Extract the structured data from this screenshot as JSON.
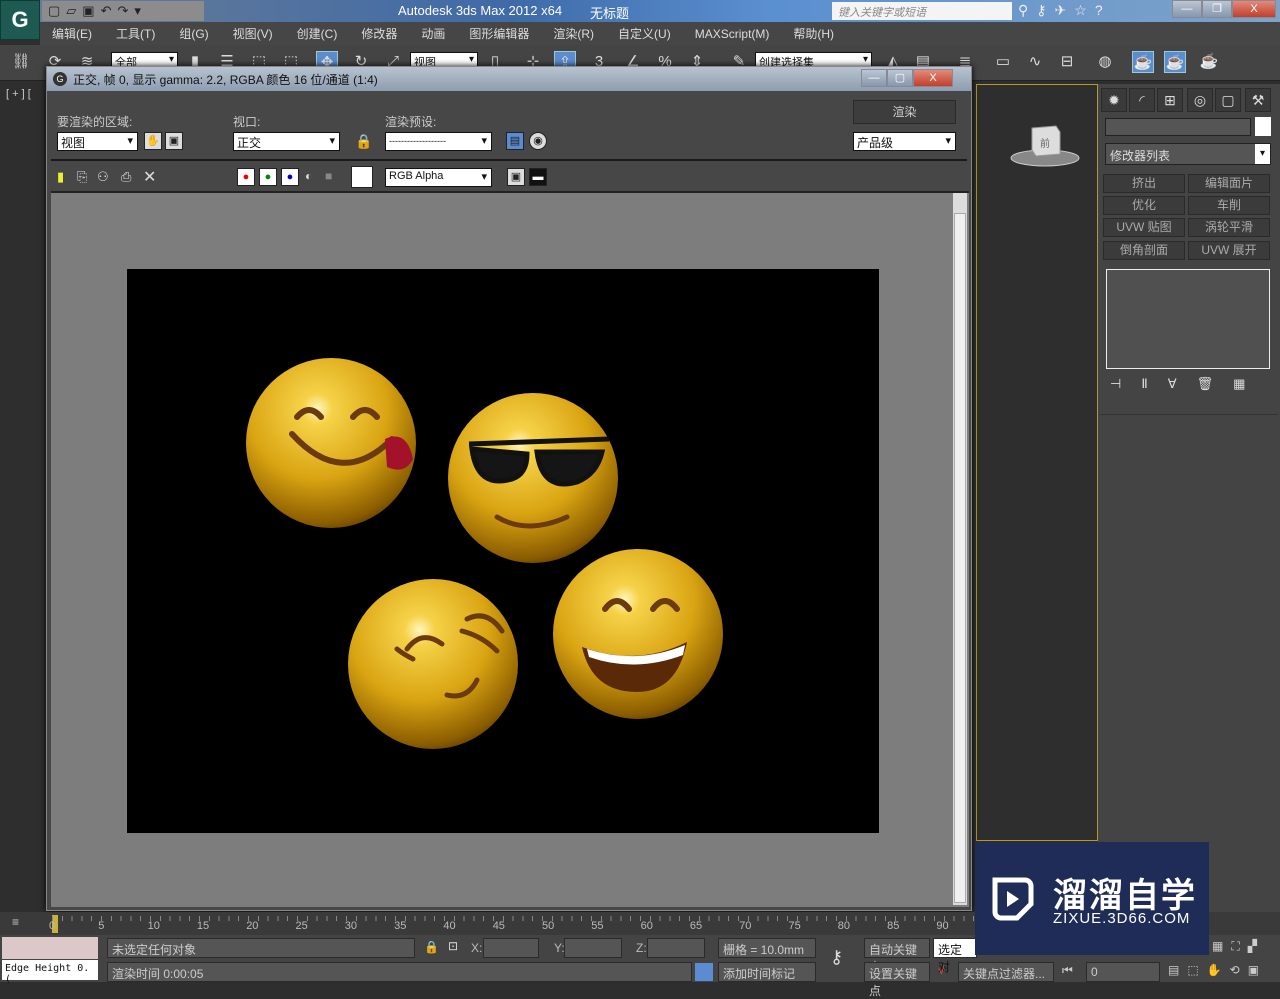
{
  "titlebar": {
    "app_title": "Autodesk 3ds Max  2012 x64",
    "doc_title": "无标题",
    "search_placeholder": "键入关键字或短语"
  },
  "menu": [
    "编辑(E)",
    "工具(T)",
    "组(G)",
    "视图(V)",
    "创建(C)",
    "修改器",
    "动画",
    "图形编辑器",
    "渲染(R)",
    "自定义(U)",
    "MAXScript(M)",
    "帮助(H)"
  ],
  "toolbar": {
    "selection_filter": "全部",
    "ref_coord": "视图",
    "named_selection": "创建选择集",
    "snap_label": "3",
    "percent_label": "%"
  },
  "viewport": {
    "label": "[ + ] [",
    "viewcube_label": "前"
  },
  "render_frame": {
    "title": "正交, 帧 0, 显示 gamma: 2.2, RGBA 颜色 16 位/通道 (1:4)",
    "area_label": "要渲染的区域:",
    "area_value": "视图",
    "viewport_label": "视口:",
    "viewport_value": "正交",
    "preset_label": "渲染预设:",
    "preset_value": "-------------------",
    "render_button": "渲染",
    "quality_value": "产品级",
    "channel_value": "RGB Alpha"
  },
  "command_panel": {
    "modifier_list": "修改器列表",
    "buttons": [
      "挤出",
      "编辑面片",
      "优化",
      "车削",
      "UVW 贴图",
      "涡轮平滑",
      "倒角剖面",
      "UVW 展开"
    ]
  },
  "timeline": {
    "ticks": [
      "0",
      "5",
      "10",
      "15",
      "20",
      "25",
      "30",
      "35",
      "40",
      "45",
      "50",
      "55",
      "60",
      "65",
      "70",
      "75",
      "80",
      "85",
      "90"
    ]
  },
  "status": {
    "maxscript_text": "Edge Height 0.(",
    "selection_status": "未选定任何对象",
    "render_time": "渲染时间  0:00:05",
    "x_label": "X:",
    "y_label": "Y:",
    "z_label": "Z:",
    "grid": "栅格 = 10.0mm",
    "add_time_tag": "添加时间标记",
    "auto_key": "自动关键点",
    "set_key": "设置关键点",
    "selected": "选定对",
    "key_filters": "关键点过滤器...",
    "frame": "0"
  },
  "watermark": {
    "name": "溜溜自学",
    "url": "ZIXUE.3D66.COM"
  },
  "colors": {
    "accent_blue": "#5b8bd0",
    "viewport_border": "#b49a2a",
    "emoji_yellow": "#e8b820",
    "watermark_bg": "#1f2c57"
  }
}
